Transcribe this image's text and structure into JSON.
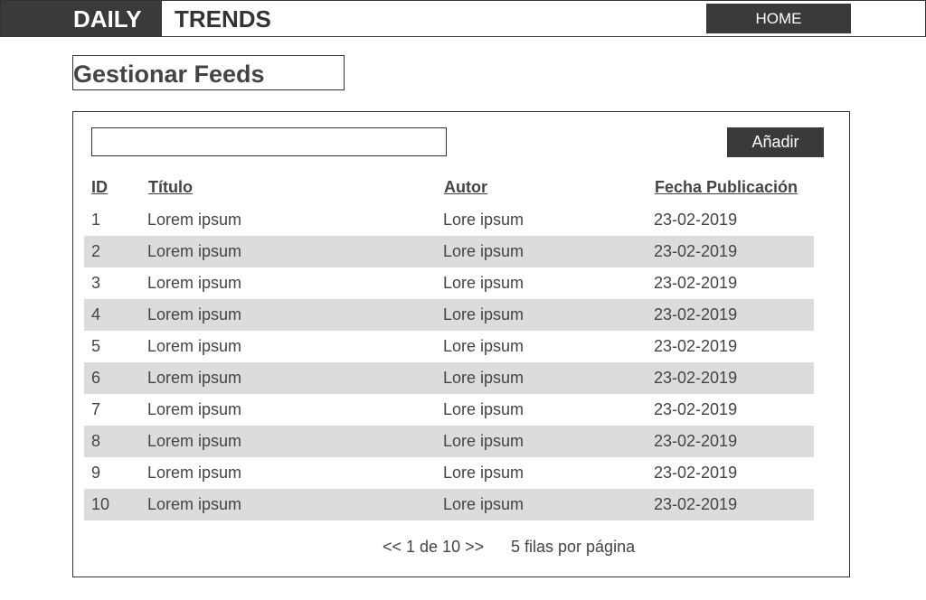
{
  "header": {
    "brand_part1": "DAILY",
    "brand_part2": "TRENDS",
    "home_label": "HOME"
  },
  "page": {
    "title": "Gestionar Feeds"
  },
  "toolbar": {
    "search_value": "",
    "add_label": "Añadir"
  },
  "table": {
    "columns": [
      "ID",
      "Título",
      "Autor",
      "Fecha Publicación"
    ],
    "rows": [
      {
        "id": "1",
        "title": "Lorem ipsum",
        "author": "Lore ipsum",
        "date": "23-02-2019"
      },
      {
        "id": "2",
        "title": "Lorem ipsum",
        "author": "Lore ipsum",
        "date": "23-02-2019"
      },
      {
        "id": "3",
        "title": "Lorem ipsum",
        "author": "Lore ipsum",
        "date": "23-02-2019"
      },
      {
        "id": "4",
        "title": "Lorem ipsum",
        "author": "Lore ipsum",
        "date": "23-02-2019"
      },
      {
        "id": "5",
        "title": "Lorem ipsum",
        "author": "Lore ipsum",
        "date": "23-02-2019"
      },
      {
        "id": "6",
        "title": "Lorem ipsum",
        "author": "Lore ipsum",
        "date": "23-02-2019"
      },
      {
        "id": "7",
        "title": "Lorem ipsum",
        "author": "Lore ipsum",
        "date": "23-02-2019"
      },
      {
        "id": "8",
        "title": "Lorem ipsum",
        "author": "Lore ipsum",
        "date": "23-02-2019"
      },
      {
        "id": "9",
        "title": "Lorem ipsum",
        "author": "Lore ipsum",
        "date": "23-02-2019"
      },
      {
        "id": "10",
        "title": "Lorem ipsum",
        "author": "Lore ipsum",
        "date": "23-02-2019"
      }
    ]
  },
  "pagination": {
    "nav_text": "<< 1 de 10 >>",
    "page_size_text": "5 filas por página"
  },
  "colors": {
    "dark": "#3a3a3a",
    "row_alt": "#dcdcdc",
    "text": "#444444"
  }
}
